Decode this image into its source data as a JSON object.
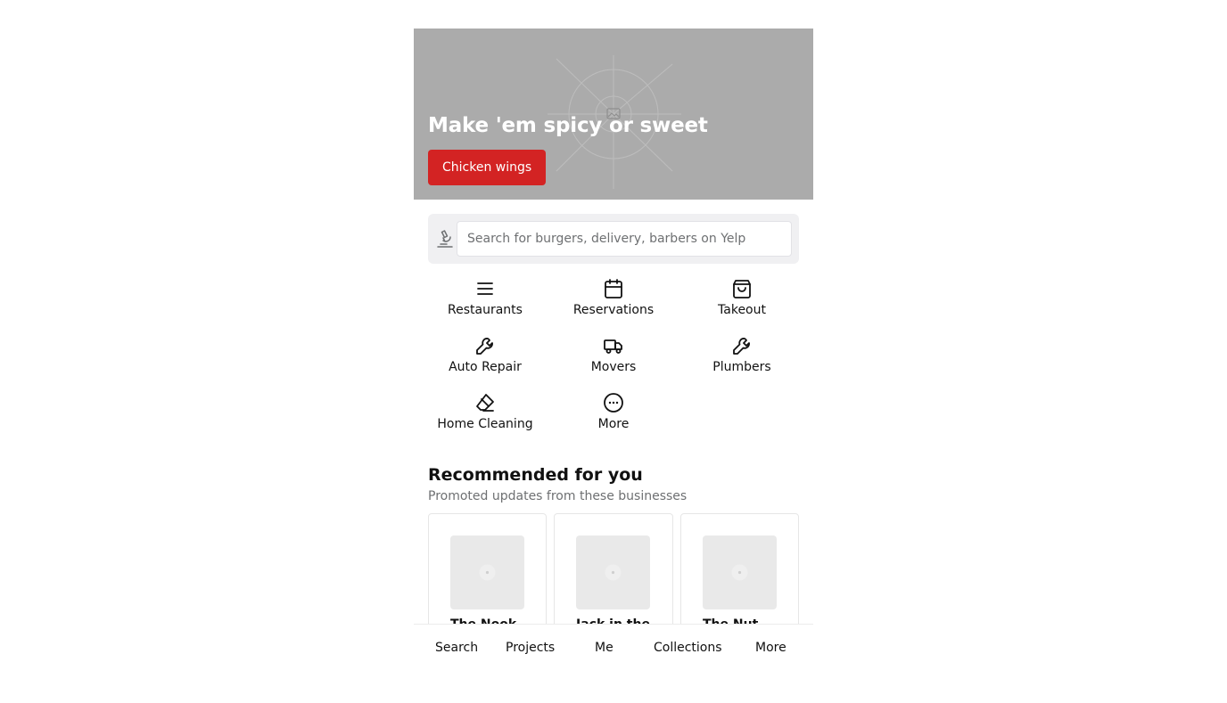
{
  "hero": {
    "title": "Make 'em spicy or sweet",
    "button_label": "Chicken wings",
    "background_color": "#ababab",
    "button_color": "#d32323"
  },
  "search": {
    "placeholder": "Search for burgers, delivery, barbers on Yelp",
    "value": "",
    "icon": "microscope-icon"
  },
  "categories": [
    {
      "label": "Restaurants",
      "icon": "menu-lines-icon"
    },
    {
      "label": "Reservations",
      "icon": "calendar-icon"
    },
    {
      "label": "Takeout",
      "icon": "shopping-bag-icon"
    },
    {
      "label": "Auto Repair",
      "icon": "wrench-icon"
    },
    {
      "label": "Movers",
      "icon": "truck-icon"
    },
    {
      "label": "Plumbers",
      "icon": "wrench-icon"
    },
    {
      "label": "Home Cleaning",
      "icon": "eraser-icon"
    },
    {
      "label": "More",
      "icon": "more-dots-icon"
    }
  ],
  "recommended": {
    "title": "Recommended for you",
    "subtitle": "Promoted updates from these businesses",
    "cards": [
      {
        "name": "The Nook"
      },
      {
        "name": "Jack in the"
      },
      {
        "name": "The Nut"
      }
    ]
  },
  "bottom_nav": {
    "items": [
      {
        "label": "Search"
      },
      {
        "label": "Projects"
      },
      {
        "label": "Me"
      },
      {
        "label": "Collections"
      },
      {
        "label": "More"
      }
    ]
  }
}
